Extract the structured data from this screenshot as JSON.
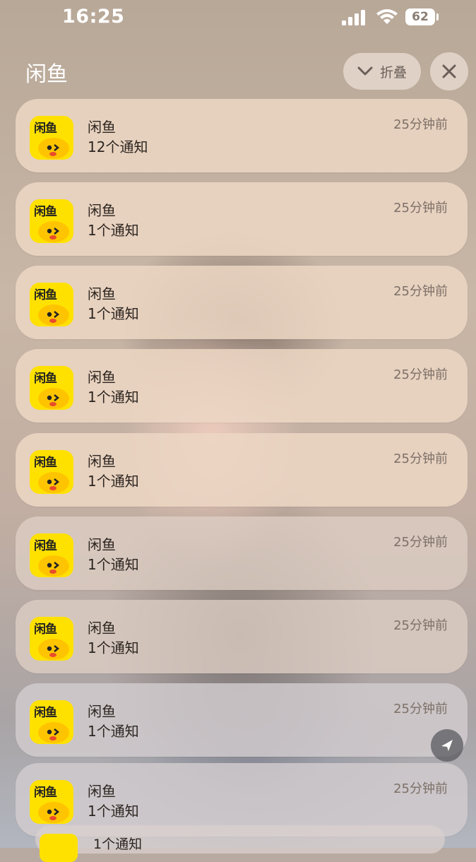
{
  "status_bar": {
    "time": "16:25",
    "battery": "62"
  },
  "header": {
    "title": "闲鱼",
    "collapse_label": "折叠"
  },
  "app_icon_text": "闲鱼",
  "notifications": [
    {
      "app": "闲鱼",
      "body": "12个通知",
      "time": "25分钟前"
    },
    {
      "app": "闲鱼",
      "body": "1个通知",
      "time": "25分钟前"
    },
    {
      "app": "闲鱼",
      "body": "1个通知",
      "time": "25分钟前"
    },
    {
      "app": "闲鱼",
      "body": "1个通知",
      "time": "25分钟前"
    },
    {
      "app": "闲鱼",
      "body": "1个通知",
      "time": "25分钟前"
    },
    {
      "app": "闲鱼",
      "body": "1个通知",
      "time": "25分钟前"
    },
    {
      "app": "闲鱼",
      "body": "1个通知",
      "time": "25分钟前"
    },
    {
      "app": "闲鱼",
      "body": "1个通知",
      "time": "25分钟前"
    },
    {
      "app": "闲鱼",
      "body": "1个通知",
      "time": "25分钟前"
    }
  ],
  "partial_item": {
    "body": "1个通知"
  },
  "colors": {
    "app_icon_bg": "#ffe100",
    "card_bg": "#ecd6c4"
  },
  "icons": {
    "collapse": "chevron-down-icon",
    "close": "close-icon",
    "floating": "send-icon"
  }
}
